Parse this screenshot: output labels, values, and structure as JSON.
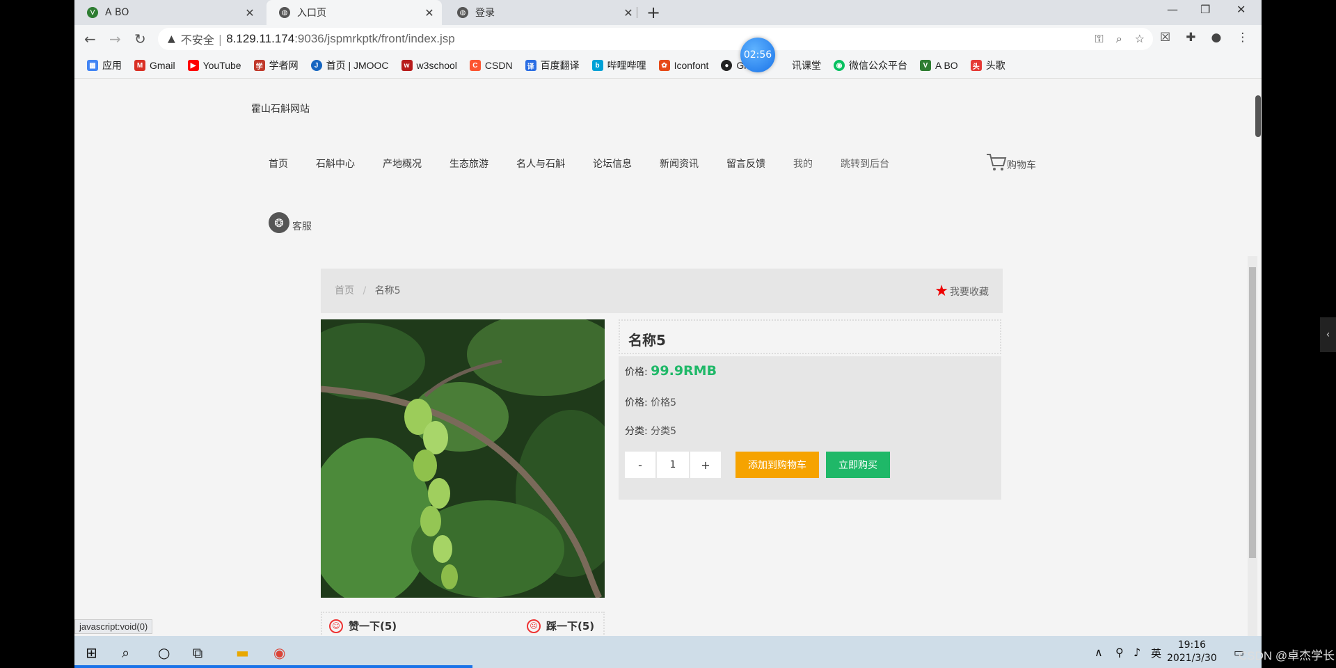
{
  "tabs": [
    {
      "title": "A BO",
      "active": false
    },
    {
      "title": "入口页",
      "active": true
    },
    {
      "title": "登录",
      "active": false
    }
  ],
  "address": {
    "insecure_label": "不安全",
    "url_host": "8.129.11.174",
    "url_path": ":9036/jspmrkptk/front/index.jsp"
  },
  "timer": "02:56",
  "bookmarks": [
    {
      "label": "应用",
      "color": "#4285f4"
    },
    {
      "label": "Gmail",
      "color": "#d93025"
    },
    {
      "label": "YouTube",
      "color": "#ff0000"
    },
    {
      "label": "学者网",
      "color": "#c0392b"
    },
    {
      "label": "首页 | JMOOC",
      "color": "#1565c0"
    },
    {
      "label": "w3school",
      "color": "#b71c1c"
    },
    {
      "label": "CSDN",
      "color": "#fc5531"
    },
    {
      "label": "百度翻译",
      "color": "#2a6de3"
    },
    {
      "label": "哔哩哔哩",
      "color": "#00a1d6"
    },
    {
      "label": "Iconfont",
      "color": "#e64a19"
    },
    {
      "label": "GitHub",
      "color": "#222222"
    },
    {
      "label": "讯课堂",
      "color": "#2196f3"
    },
    {
      "label": "微信公众平台",
      "color": "#07c160"
    },
    {
      "label": "A BO",
      "color": "#2e7d32"
    },
    {
      "label": "头歌",
      "color": "#e53935"
    }
  ],
  "site": {
    "title": "霍山石斛网站",
    "nav": [
      {
        "label": "首页",
        "muted": false
      },
      {
        "label": "石斛中心",
        "muted": false
      },
      {
        "label": "产地概况",
        "muted": false
      },
      {
        "label": "生态旅游",
        "muted": false
      },
      {
        "label": "名人与石斛",
        "muted": false
      },
      {
        "label": "论坛信息",
        "muted": false
      },
      {
        "label": "新闻资讯",
        "muted": false
      },
      {
        "label": "留言反馈",
        "muted": false
      },
      {
        "label": "我的",
        "muted": true
      },
      {
        "label": "跳转到后台",
        "muted": true
      }
    ],
    "cart_label": "购物车",
    "service_label": "客服"
  },
  "breadcrumb": {
    "home": "首页",
    "separator": "/",
    "current": "名称5",
    "favorite_label": "我要收藏"
  },
  "product": {
    "name": "名称5",
    "price_label": "价格:",
    "price_value": "99.9RMB",
    "price2_label": "价格:",
    "price2_value": "价格5",
    "category_label": "分类:",
    "category_value": "分类5",
    "qty_minus": "-",
    "qty_value": "1",
    "qty_plus": "+",
    "add_to_cart": "添加到购物车",
    "buy_now": "立即购买",
    "like_label": "赞一下(5)",
    "dislike_label": "踩一下(5)"
  },
  "status_bar": "javascript:void(0)",
  "taskbar": {
    "ime": "英",
    "time": "19:16",
    "date": "2021/3/30"
  },
  "watermark": "CSDN @卓杰学长"
}
